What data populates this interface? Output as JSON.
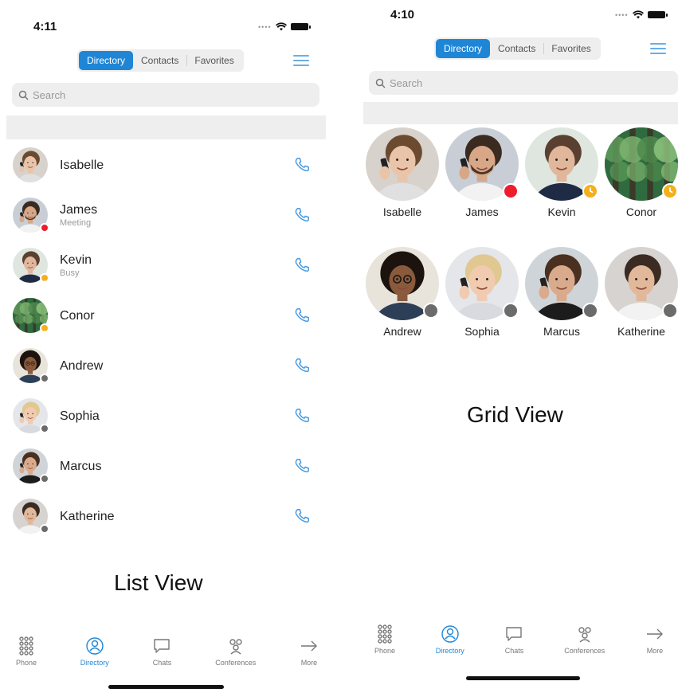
{
  "left_screen": {
    "time": "4:11",
    "segments": [
      "Directory",
      "Contacts",
      "Favorites"
    ],
    "active_segment": 0,
    "search_placeholder": "Search",
    "caption": "List View",
    "contacts": [
      {
        "name": "Isabelle",
        "status": "",
        "presence": "none",
        "avatar": "isabelle"
      },
      {
        "name": "James",
        "status": "Meeting",
        "presence": "busy-red",
        "avatar": "james"
      },
      {
        "name": "Kevin",
        "status": "Busy",
        "presence": "away",
        "avatar": "kevin"
      },
      {
        "name": "Conor",
        "status": "",
        "presence": "away",
        "avatar": "conor"
      },
      {
        "name": "Andrew",
        "status": "",
        "presence": "offline",
        "avatar": "andrew"
      },
      {
        "name": "Sophia",
        "status": "",
        "presence": "offline",
        "avatar": "sophia"
      },
      {
        "name": "Marcus",
        "status": "",
        "presence": "offline",
        "avatar": "marcus"
      },
      {
        "name": "Katherine",
        "status": "",
        "presence": "offline",
        "avatar": "katherine"
      }
    ]
  },
  "right_screen": {
    "time": "4:10",
    "segments": [
      "Directory",
      "Contacts",
      "Favorites"
    ],
    "active_segment": 0,
    "search_placeholder": "Search",
    "caption": "Grid View",
    "contacts": [
      {
        "name": "Isabelle",
        "presence": "none",
        "avatar": "isabelle"
      },
      {
        "name": "James",
        "presence": "busy-red",
        "avatar": "james"
      },
      {
        "name": "Kevin",
        "presence": "away",
        "avatar": "kevin"
      },
      {
        "name": "Conor",
        "presence": "away",
        "avatar": "conor"
      },
      {
        "name": "Andrew",
        "presence": "offline",
        "avatar": "andrew"
      },
      {
        "name": "Sophia",
        "presence": "offline",
        "avatar": "sophia"
      },
      {
        "name": "Marcus",
        "presence": "offline",
        "avatar": "marcus"
      },
      {
        "name": "Katherine",
        "presence": "offline",
        "avatar": "katherine"
      }
    ]
  },
  "tabbar": {
    "items": [
      {
        "label": "Phone",
        "icon": "dialpad-icon"
      },
      {
        "label": "Directory",
        "icon": "directory-icon"
      },
      {
        "label": "Chats",
        "icon": "chat-bubble-icon"
      },
      {
        "label": "Conferences",
        "icon": "conferences-icon"
      },
      {
        "label": "More",
        "icon": "more-arrow-icon"
      }
    ],
    "active": 1
  },
  "colors": {
    "accent": "#1f86d6",
    "presence_busy": "#ee1c2c",
    "presence_away": "#f3b01b",
    "presence_offline": "#6b6b6b"
  }
}
